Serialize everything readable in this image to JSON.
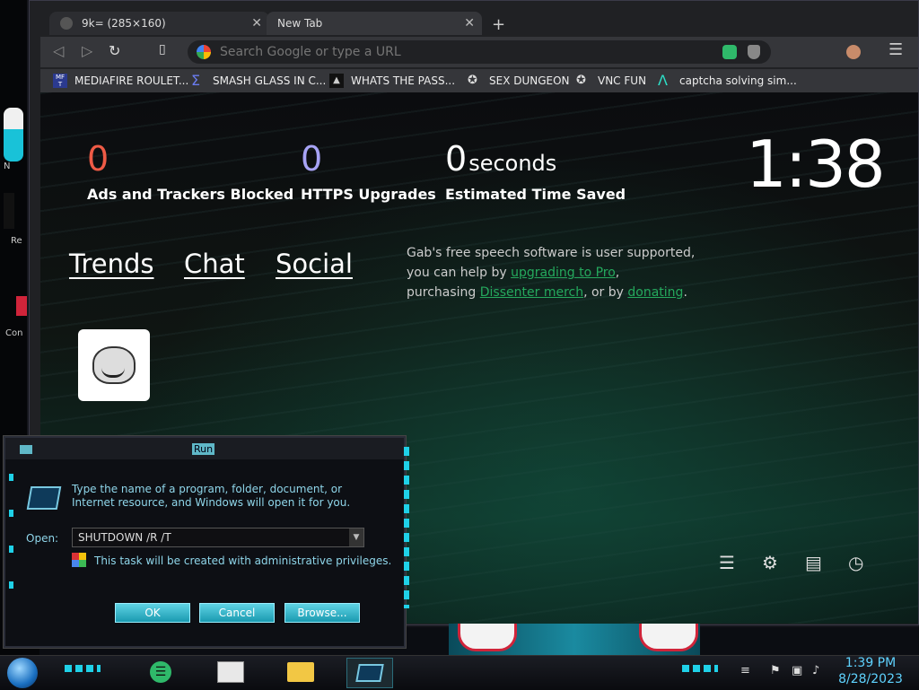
{
  "desktop": {
    "icons": [
      {
        "label": "N",
        "top": 0
      },
      {
        "label": "Re",
        "top": 0
      },
      {
        "label": "Con",
        "top": 0
      }
    ]
  },
  "browser": {
    "tabs": [
      {
        "title": "9k= (285×160)",
        "active": false
      },
      {
        "title": "New Tab",
        "active": true
      }
    ],
    "new_tab_symbol": "+",
    "omnibox_placeholder": "Search Google or type a URL",
    "bookmarks": [
      {
        "label": "MEDIAFIRE ROULET...",
        "icon": "mediafire-icon"
      },
      {
        "label": "SMASH GLASS IN C...",
        "icon": "sigma-icon"
      },
      {
        "label": "WHATS THE PASS...",
        "icon": "lock-icon"
      },
      {
        "label": "SEX DUNGEON",
        "icon": "badge-icon"
      },
      {
        "label": "VNC FUN",
        "icon": "badge-icon"
      },
      {
        "label": "captcha solving sim...",
        "icon": "lambda-icon"
      }
    ]
  },
  "ntp": {
    "stats": [
      {
        "number": "0",
        "unit": "",
        "label": "Ads and Trackers Blocked",
        "color": "#ef5b46"
      },
      {
        "number": "0",
        "unit": "",
        "label": "HTTPS Upgrades",
        "color": "#a7a3f5"
      },
      {
        "number": "0",
        "unit": "seconds",
        "label": "Estimated Time Saved",
        "color": "#ffffff"
      }
    ],
    "clock": "1:38",
    "links": [
      "Trends",
      "Chat",
      "Social"
    ],
    "gab": {
      "line1": "Gab's free speech software is user supported,",
      "line2_pre": "you can help by ",
      "link1": "upgrading to Pro",
      "line2_post": ",",
      "line3_pre": "purchasing ",
      "link2": "Dissenter merch",
      "line3_mid": ", or by ",
      "link3": "donating",
      "line3_post": "."
    },
    "accent": "#25a95d"
  },
  "run_dialog": {
    "title": "Run",
    "description": "Type the name of a program, folder, document, or Internet resource, and Windows will open it for you.",
    "open_label": "Open:",
    "open_value": "SHUTDOWN /R /T",
    "admin_note": "This task will be created with administrative privileges.",
    "buttons": {
      "ok": "OK",
      "cancel": "Cancel",
      "browse": "Browse..."
    }
  },
  "taskbar": {
    "time": "1:39 PM",
    "date": "8/28/2023"
  }
}
